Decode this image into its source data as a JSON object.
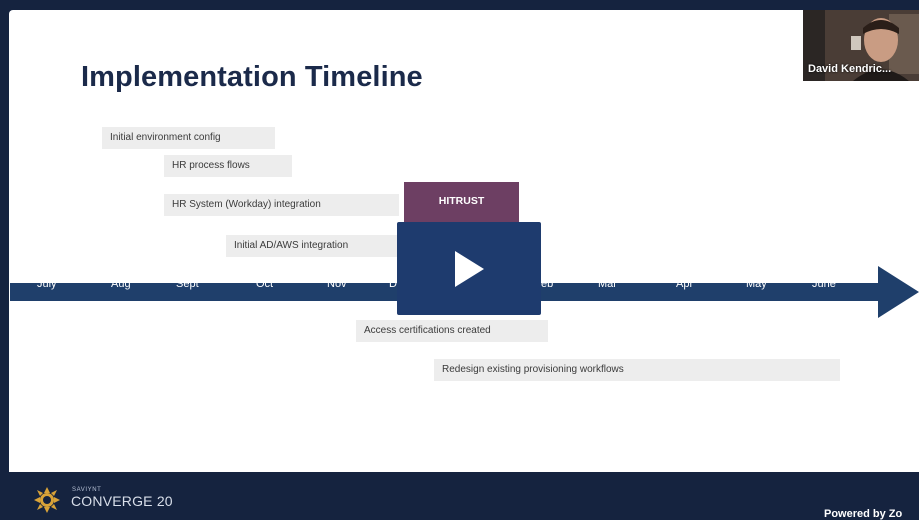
{
  "slide": {
    "title": "Implementation Timeline",
    "bars": [
      {
        "label": "Initial environment config"
      },
      {
        "label": "HR process flows"
      },
      {
        "label": "HR System (Workday) integration"
      },
      {
        "label": "Initial AD/AWS integration"
      },
      {
        "label": "Access certifications created"
      },
      {
        "label": "Redesign existing provisioning workflows"
      }
    ],
    "milestone": {
      "label": "HITRUST",
      "color": "#6d3f63"
    },
    "months": [
      "July",
      "Aug",
      "Sept",
      "Oct",
      "Nov",
      "D",
      "eb",
      "Mar",
      "Apr",
      "May",
      "June"
    ],
    "timeline_color": "#1f3f6b"
  },
  "video": {
    "participant": "David Kendric...",
    "play_icon": "play-icon"
  },
  "footer": {
    "brand_small": "SAVIYNT",
    "brand_main": "CONVERGE 20",
    "powered_by": "Powered by Zo",
    "logo_icon": "sun-gear-icon"
  }
}
